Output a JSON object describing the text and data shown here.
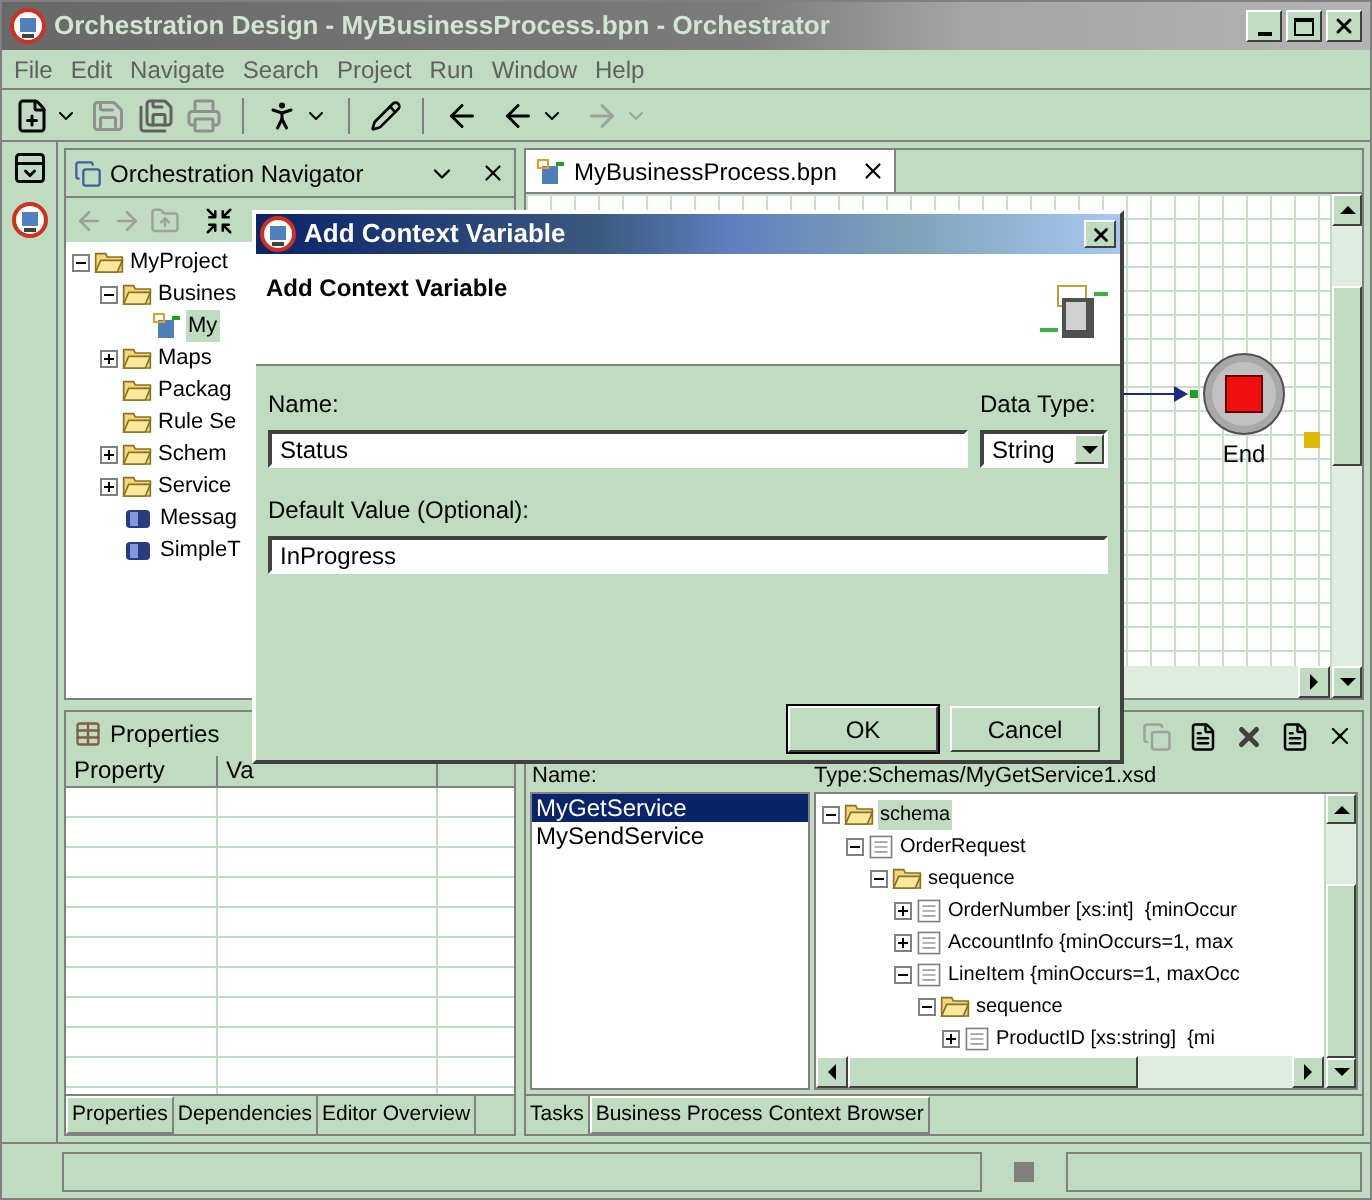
{
  "window": {
    "title": "Orchestration Design - MyBusinessProcess.bpn - Orchestrator"
  },
  "menu": [
    "File",
    "Edit",
    "Navigate",
    "Search",
    "Project",
    "Run",
    "Window",
    "Help"
  ],
  "navigator": {
    "title": "Orchestration Navigator",
    "tree": [
      {
        "label": "MyProject",
        "kind": "project",
        "expandable": true,
        "expanded": true,
        "selected": false,
        "children": [
          {
            "label": "Busines",
            "kind": "folder",
            "expandable": true,
            "expanded": true,
            "selected": false,
            "children": [
              {
                "label": "My",
                "kind": "process",
                "expandable": false,
                "selected": true
              }
            ]
          },
          {
            "label": "Maps",
            "kind": "folder",
            "expandable": true,
            "expanded": false,
            "selected": false
          },
          {
            "label": "Packag",
            "kind": "folder",
            "expandable": false,
            "selected": false
          },
          {
            "label": "Rule Se",
            "kind": "folder",
            "expandable": false,
            "selected": false
          },
          {
            "label": "Schem",
            "kind": "folder",
            "expandable": true,
            "expanded": false,
            "selected": false
          },
          {
            "label": "Service",
            "kind": "folder",
            "expandable": true,
            "expanded": false,
            "selected": false
          },
          {
            "label": "Messag",
            "kind": "message",
            "expandable": false,
            "selected": false
          },
          {
            "label": "SimpleT",
            "kind": "message",
            "expandable": false,
            "selected": false
          }
        ]
      }
    ]
  },
  "editor": {
    "tab": "MyBusinessProcess.bpn",
    "node": "End"
  },
  "properties": {
    "title": "Properties",
    "columns": [
      "Property",
      "Va"
    ],
    "tabs": [
      {
        "label": "Properties",
        "selected": true
      },
      {
        "label": "Dependencies",
        "selected": false
      },
      {
        "label": "Editor Overview",
        "selected": false
      }
    ]
  },
  "context_browser": {
    "list_label": "Name:",
    "type_label": "Type:Schemas/MyGetService1.xsd",
    "services": [
      {
        "label": "MyGetService",
        "selected": true
      },
      {
        "label": "MySendService",
        "selected": false
      }
    ],
    "tree": [
      {
        "label": "schema",
        "kind": "folder",
        "expandable": true,
        "expanded": true,
        "selected": true,
        "children": [
          {
            "label": "OrderRequest",
            "kind": "element",
            "expandable": true,
            "expanded": true,
            "selected": false,
            "children": [
              {
                "label": "sequence",
                "kind": "folder",
                "expandable": true,
                "expanded": true,
                "selected": false,
                "children": [
                  {
                    "label": "OrderNumber [xs:int]  {minOccur",
                    "kind": "element",
                    "expandable": true,
                    "expanded": false,
                    "selected": false
                  },
                  {
                    "label": "AccountInfo {minOccurs=1, max",
                    "kind": "element",
                    "expandable": true,
                    "expanded": false,
                    "selected": false
                  },
                  {
                    "label": "LineItem {minOccurs=1, maxOcc",
                    "kind": "element",
                    "expandable": true,
                    "expanded": true,
                    "selected": false,
                    "children": [
                      {
                        "label": "sequence",
                        "kind": "folder",
                        "expandable": true,
                        "expanded": true,
                        "selected": false,
                        "children": [
                          {
                            "label": "ProductID [xs:string]  {mi",
                            "kind": "element",
                            "expandable": true,
                            "expanded": false,
                            "selected": false
                          }
                        ]
                      }
                    ]
                  }
                ]
              }
            ]
          }
        ]
      }
    ],
    "tabs": [
      {
        "label": "Tasks",
        "selected": false
      },
      {
        "label": "Business Process Context Browser",
        "selected": true
      }
    ]
  },
  "dialog": {
    "title": "Add Context Variable",
    "heading": "Add Context Variable",
    "name_label": "Name:",
    "name_value": "Status",
    "type_label": "Data Type:",
    "type_value": "String",
    "default_label": "Default Value (Optional):",
    "default_value": "InProgress",
    "buttons": [
      "OK",
      "Cancel"
    ]
  }
}
